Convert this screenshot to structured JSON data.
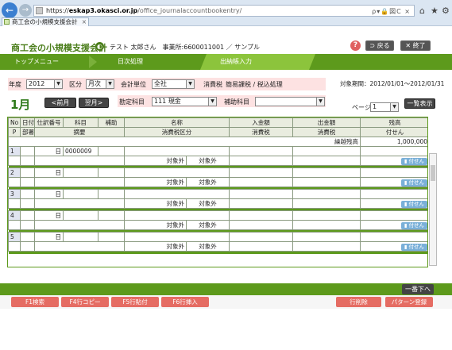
{
  "browser": {
    "url_prefix": "https://",
    "url_host": "eskap3.okasci.or.jp",
    "url_path": "/office_journalaccountbookentry/",
    "tab_title": "商工会の小規模支援会計",
    "tab_close": "×",
    "addr_tools": "ρ▾🔒図C ×"
  },
  "app": {
    "brand": "商工会の小規模支援会計",
    "user_info": "テスト 太郎さん　事業所:6600011001 ／ サンプル",
    "help": "?",
    "back_label": "戻る",
    "exit_label": "終了"
  },
  "nav": {
    "top": "トップメニュー",
    "daily": "日次処理",
    "active": "出納帳入力"
  },
  "filter": {
    "year_label": "年度",
    "year_value": "2012",
    "kubun_label": "区分",
    "kubun_value": "月次",
    "unit_label": "会計単位",
    "unit_value": "全社",
    "tax_label": "消費税",
    "tax_value": "簡易課税 / 税込処理",
    "period": "対象期間：2012/01/01～2012/01/31",
    "month": "1月",
    "prev_month": "<前月",
    "next_month": "翌月>",
    "account_label": "勘定科目",
    "account_value": "111 現金",
    "sub_label": "補助科目",
    "sub_value": "",
    "page_label": "ページ",
    "page_value": "1",
    "list_button": "一覧表示"
  },
  "grid": {
    "header1": [
      "No",
      "日付",
      "仕訳番号",
      "科目",
      "補助",
      "名称",
      "入金額",
      "出金額",
      "残高"
    ],
    "header2": [
      "P",
      "部署",
      "摘要",
      "消費税区分",
      "消費税",
      "消費税",
      "付せん"
    ],
    "carry_label": "繰越残高",
    "carry_value": "1,000,000",
    "day_label": "日",
    "tax_out": "対象外",
    "tag_label": "付せん",
    "rows": [
      {
        "no": "1",
        "journal": "0000009"
      },
      {
        "no": "2",
        "journal": ""
      },
      {
        "no": "3",
        "journal": ""
      },
      {
        "no": "4",
        "journal": ""
      },
      {
        "no": "5",
        "journal": ""
      }
    ]
  },
  "footer": {
    "bottom": "一番下へ",
    "f1": "F1検索",
    "f4": "F4行コピー",
    "f5": "F5行貼付",
    "f6": "F6行挿入",
    "del": "行削除",
    "pattern": "パターン登録"
  }
}
